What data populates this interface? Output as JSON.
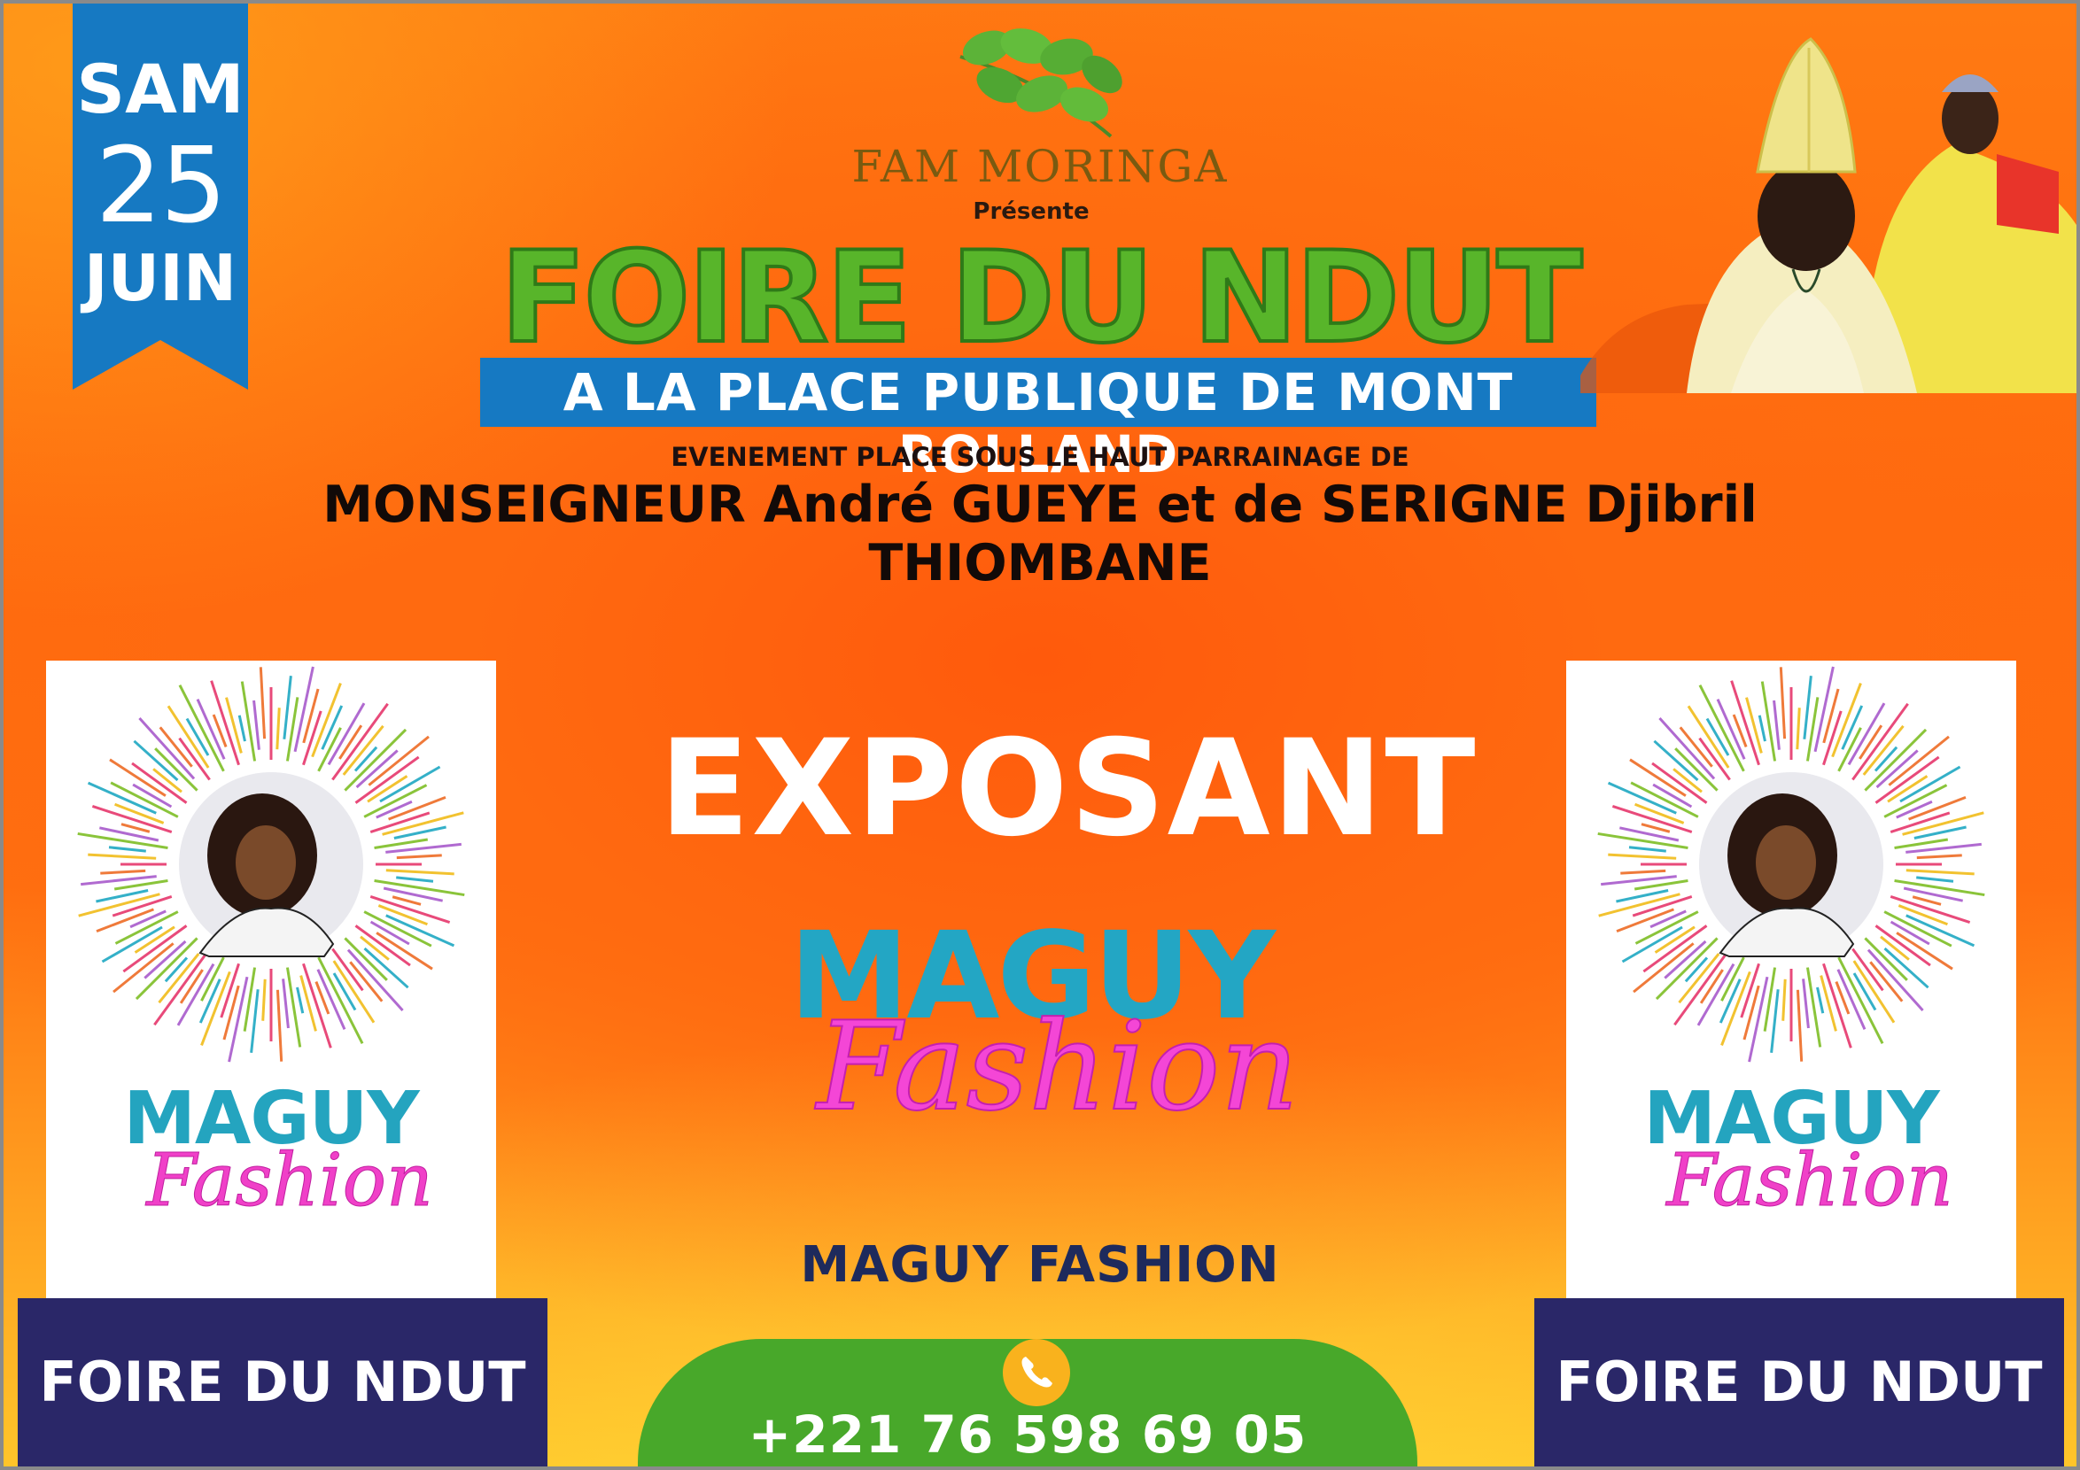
{
  "date": {
    "day": "SAM",
    "number": "25",
    "month": "JUIN"
  },
  "logo": {
    "name": "FAM MORINGA",
    "presents": "Présente",
    "icon": "moringa-leaves-icon"
  },
  "event": {
    "title": "FOIRE DU NDUT",
    "location": "A LA PLACE PUBLIQUE DE MONT ROLLAND",
    "patronage_intro": "EVENEMENT PLACE SOUS LE HAUT PARRAINAGE DE",
    "patrons": "MONSEIGNEUR André GUEYE et de SERIGNE Djibril THIOMBANE"
  },
  "exhibitor": {
    "heading": "EXPOSANT",
    "brand_word1": "MAGUY",
    "brand_word2": "Fashion",
    "name": "MAGUY FASHION",
    "phone": "+221 76 598 69 05",
    "phone_icon": "phone-icon"
  },
  "side_panels": {
    "left": {
      "brand_word1": "MAGUY",
      "brand_word2": "Fashion",
      "footer": "FOIRE DU NDUT"
    },
    "right": {
      "brand_word1": "MAGUY",
      "brand_word2": "Fashion",
      "footer": "FOIRE DU NDUT"
    }
  },
  "colors": {
    "background": "#ff6a0e",
    "ribbon": "#1679c2",
    "title_green": "#58b52a",
    "band_blue": "#1679c2",
    "navy": "#2a2768",
    "maguy_teal": "#23a6c4",
    "fashion_pink": "#f446d6",
    "phone_green": "#48a82a",
    "phone_icon_yellow": "#f9b21d"
  }
}
